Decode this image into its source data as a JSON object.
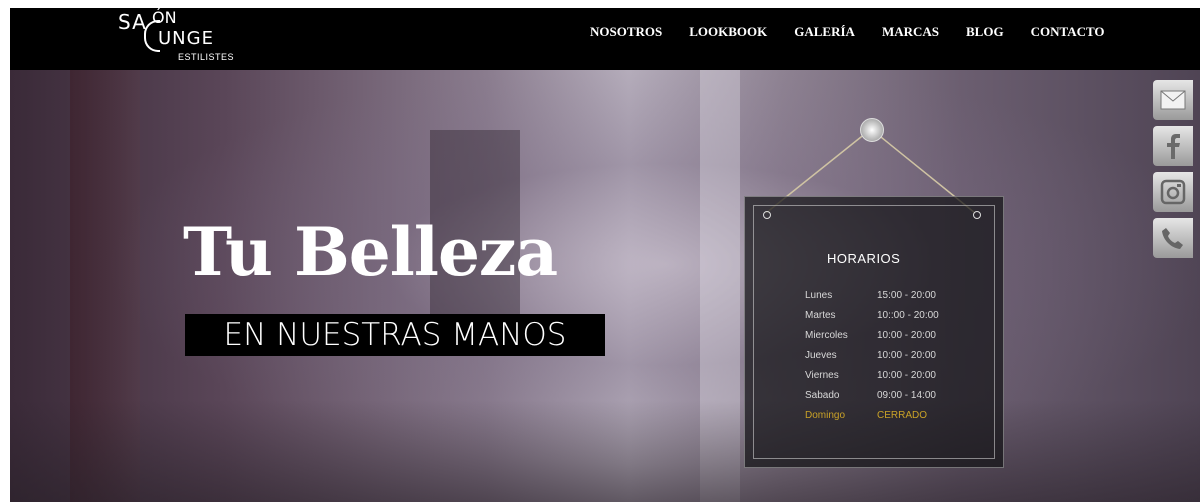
{
  "brand": {
    "logo_sa": "SA",
    "logo_on": "ÓN",
    "logo_unge": "UNGE",
    "logo_estilistes": "ESTILISTES"
  },
  "nav": {
    "items": [
      "NOSOTROS",
      "LOOKBOOK",
      "GALERÍA",
      "MARCAS",
      "BLOG",
      "CONTACTO"
    ]
  },
  "hero": {
    "headline": "Tu Belleza",
    "subheadline": "EN NUESTRAS MANOS"
  },
  "schedule": {
    "title": "HORARIOS",
    "rows": [
      {
        "day": "Lunes",
        "hours": "15:00 - 20:00"
      },
      {
        "day": "Martes",
        "hours": "10::00 - 20:00"
      },
      {
        "day": "Miercoles",
        "hours": "10:00 - 20:00"
      },
      {
        "day": "Jueves",
        "hours": "10:00 - 20:00"
      },
      {
        "day": "Viernes",
        "hours": "10:00 - 20:00"
      },
      {
        "day": "Sabado",
        "hours": "09:00 - 14:00"
      },
      {
        "day": "Domingo",
        "hours": "CERRADO"
      }
    ],
    "closed_color": "#c9a227"
  },
  "social": {
    "icons": [
      "mail-icon",
      "facebook-icon",
      "instagram-icon",
      "phone-icon"
    ]
  }
}
